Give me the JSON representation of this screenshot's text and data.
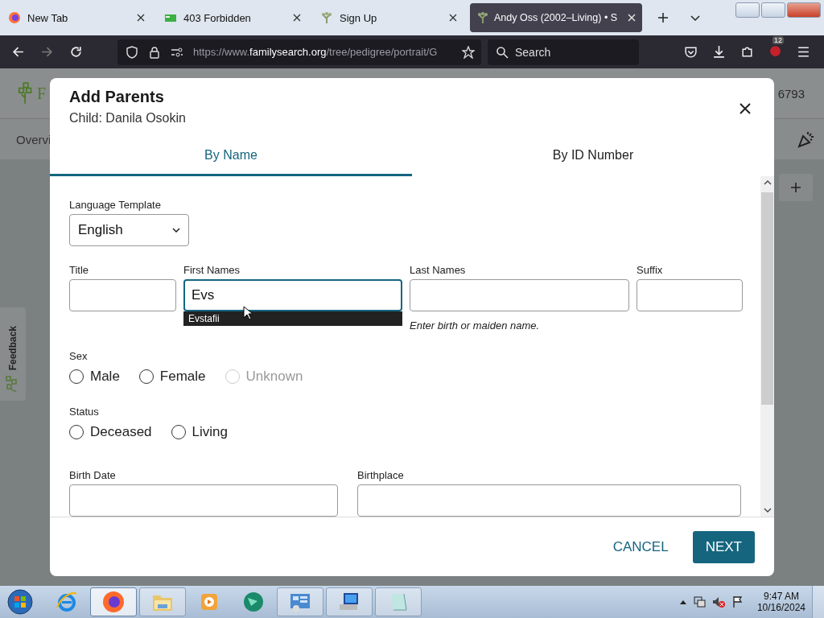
{
  "browser": {
    "tabs": [
      {
        "title": "New Tab",
        "selected": false
      },
      {
        "title": "403 Forbidden",
        "selected": false
      },
      {
        "title": "Sign Up",
        "selected": false
      },
      {
        "title": "Andy Oss (2002–Living) • S",
        "selected": true
      }
    ],
    "url": {
      "scheme": "https://www.",
      "domain": "familysearch.org",
      "path": "/tree/pedigree/portrait/G"
    },
    "search_placeholder": "Search",
    "extensions_badge": "12"
  },
  "page": {
    "logo_text": "F",
    "account_text": "6793",
    "nav_text": "Overvi",
    "feedback": "Feedback"
  },
  "dialog": {
    "title": "Add Parents",
    "subtitle": "Child: Danila Osokin",
    "tabs": [
      {
        "label": "By Name",
        "selected": true
      },
      {
        "label": "By ID Number",
        "selected": false
      }
    ],
    "language": {
      "label": "Language Template",
      "value": "English"
    },
    "name_fields": [
      {
        "label": "Title",
        "focused": false
      },
      {
        "label": "First Names",
        "value": "Evs",
        "focused": true,
        "suggestion": "Evstafii"
      },
      {
        "label": "Last Names",
        "focused": false,
        "hint": "Enter birth or maiden name."
      },
      {
        "label": "Suffix",
        "focused": false
      }
    ],
    "radio_groups": [
      {
        "label": "Sex",
        "options": [
          {
            "label": "Male",
            "selected": false,
            "disabled": false
          },
          {
            "label": "Female",
            "selected": false,
            "disabled": false
          },
          {
            "label": "Unknown",
            "selected": false,
            "disabled": true
          }
        ]
      },
      {
        "label": "Status",
        "options": [
          {
            "label": "Deceased",
            "selected": false,
            "disabled": false
          },
          {
            "label": "Living",
            "selected": false,
            "disabled": false
          }
        ]
      }
    ],
    "event_fields": [
      {
        "label": "Birth Date"
      },
      {
        "label": "Birthplace"
      }
    ],
    "cancel": "CANCEL",
    "next": "NEXT"
  },
  "taskbar": {
    "apps": [
      {
        "kind": "ie",
        "active": false
      },
      {
        "kind": "firefox",
        "active": true
      },
      {
        "kind": "folder",
        "active": false
      },
      {
        "kind": "media",
        "active": false
      },
      {
        "kind": "globe",
        "active": false
      },
      {
        "kind": "panel",
        "active": false
      },
      {
        "kind": "network",
        "active": false
      },
      {
        "kind": "notepad",
        "active": false
      }
    ],
    "time": "9:47 AM",
    "date": "10/16/2024"
  }
}
